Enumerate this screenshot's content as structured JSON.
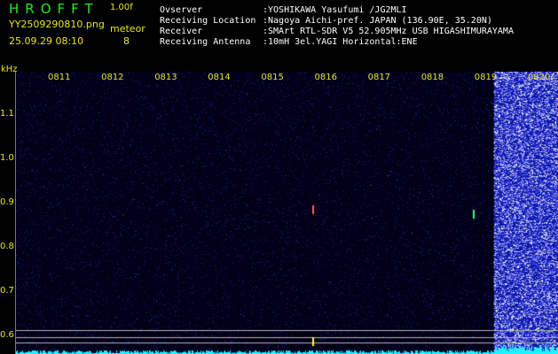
{
  "header": {
    "app_title": "HROFFT",
    "version": "1.00f",
    "file_name": "YY2509290810.png",
    "datetime": "25.09.29 08:10",
    "meteor_label": "meteor",
    "meteor_count": "8"
  },
  "station_info": [
    {
      "label": "Ovserver",
      "value": ":YOSHIKAWA Yasufumi /JG2MLI"
    },
    {
      "label": "Receiving Location",
      "value": ":Nagoya Aichi-pref. JAPAN (136.90E, 35.20N)"
    },
    {
      "label": "Receiver",
      "value": ":SMArt RTL-SDR V5 52.905MHz USB HIGASHIMURAYAMA"
    },
    {
      "label": "Receiving Antenna",
      "value": ":10mH 3el.YAGI Horizontal:ENE"
    }
  ],
  "spectrogram": {
    "freq_unit": "kHz",
    "time_ticks": [
      "0811",
      "0812",
      "0813",
      "0814",
      "0815",
      "0816",
      "0817",
      "0818",
      "0819",
      "0820"
    ],
    "freq_ticks": [
      "1.1",
      "1.0",
      "0.9",
      "0.8",
      "0.7",
      "0.6"
    ],
    "freq_range_khz": [
      0.575,
      1.195
    ],
    "minute_range": [
      0,
      10
    ],
    "noise_burst_start_minute": 8.2,
    "meteor_echoes": [
      {
        "minute": 4.8,
        "freq_khz": 0.885,
        "color": "#ff6060"
      },
      {
        "minute": 7.8,
        "freq_khz": 0.875,
        "color": "#30ff90"
      },
      {
        "minute": 4.8,
        "freq_khz": 0.587,
        "color": "#ffff30"
      }
    ],
    "colors": {
      "background": "#000018",
      "noise": "#3c3cff",
      "burst": "#ffffff",
      "baseline": "#20f0ff",
      "marker_lines": "#b4b4b4"
    }
  }
}
